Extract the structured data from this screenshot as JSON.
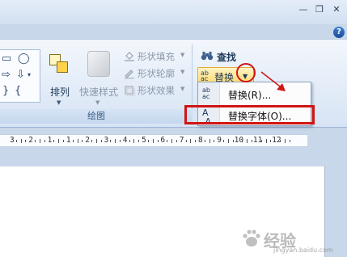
{
  "window": {
    "minimize_glyph": "—",
    "restore_glyph": "❐",
    "close_glyph": "✕",
    "help_glyph": "?"
  },
  "ribbon": {
    "drawing_group": {
      "label": "绘图",
      "arrange_label": "排列",
      "quick_styles_label": "快速样式",
      "shape_fill_label": "形状填充",
      "shape_outline_label": "形状轮廓",
      "shape_effects_label": "形状效果"
    },
    "editing_group": {
      "find_label": "查找",
      "replace_label": "替换"
    }
  },
  "dropdown_menu": {
    "items": [
      {
        "label": "替换(R)...",
        "icon": "replace-icon"
      },
      {
        "label": "替换字体(O)...",
        "icon": "replace-font-icon"
      }
    ]
  },
  "ruler": {
    "numbers": [
      "3",
      "2",
      "1",
      "1",
      "2",
      "3",
      "4",
      "5",
      "6",
      "7",
      "8",
      "9",
      "10",
      "11",
      "12"
    ]
  },
  "annotation_colors": {
    "highlight": "#d01515"
  },
  "watermark": {
    "text": "经验",
    "url": "jingyan.baidu.com"
  }
}
